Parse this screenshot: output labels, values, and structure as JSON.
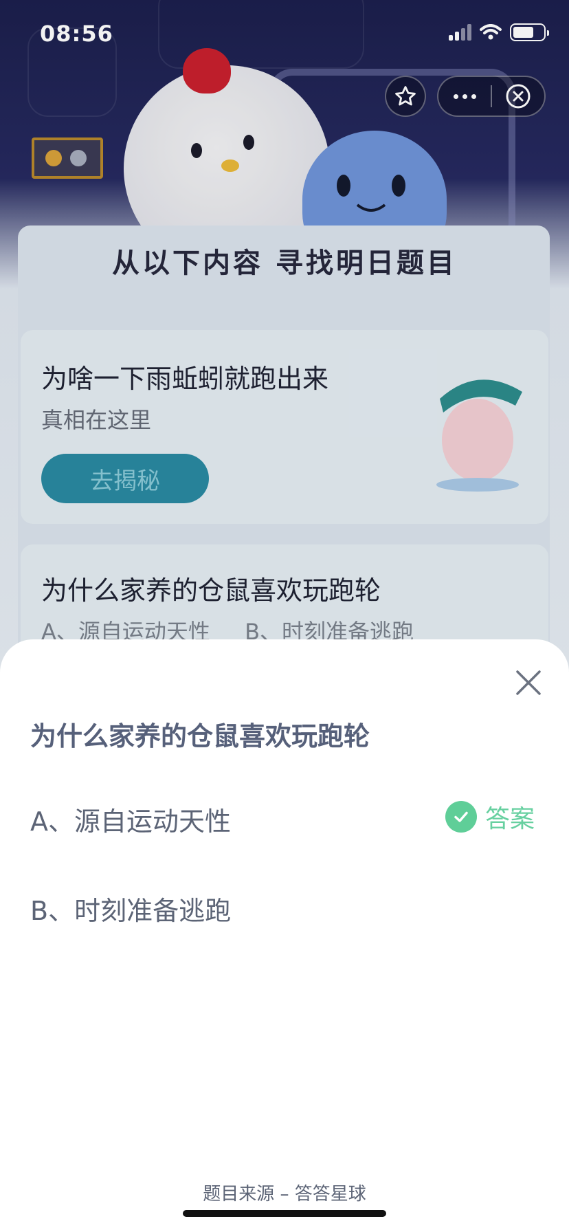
{
  "status_bar": {
    "time": "08:56"
  },
  "background": {
    "banner": "从以下内容 寻找明日题目",
    "card1": {
      "title": "为啥一下雨蚯蚓就跑出来",
      "subtitle": "真相在这里",
      "button": "去揭秘"
    },
    "card2": {
      "title": "为什么家养的仓鼠喜欢玩跑轮",
      "option_a": "A、源自运动天性",
      "option_b": "B、时刻准备逃跑"
    }
  },
  "sheet": {
    "question": "为什么家养的仓鼠喜欢玩跑轮",
    "options": [
      {
        "label": "A、源自运动天性",
        "correct": true
      },
      {
        "label": "B、时刻准备逃跑",
        "correct": false
      }
    ],
    "answer_label": "答案",
    "source": "题目来源 – 答答星球"
  },
  "colors": {
    "answer_green": "#5fce98",
    "question_text": "#56607a",
    "header_bg": "#1c1f4d"
  }
}
